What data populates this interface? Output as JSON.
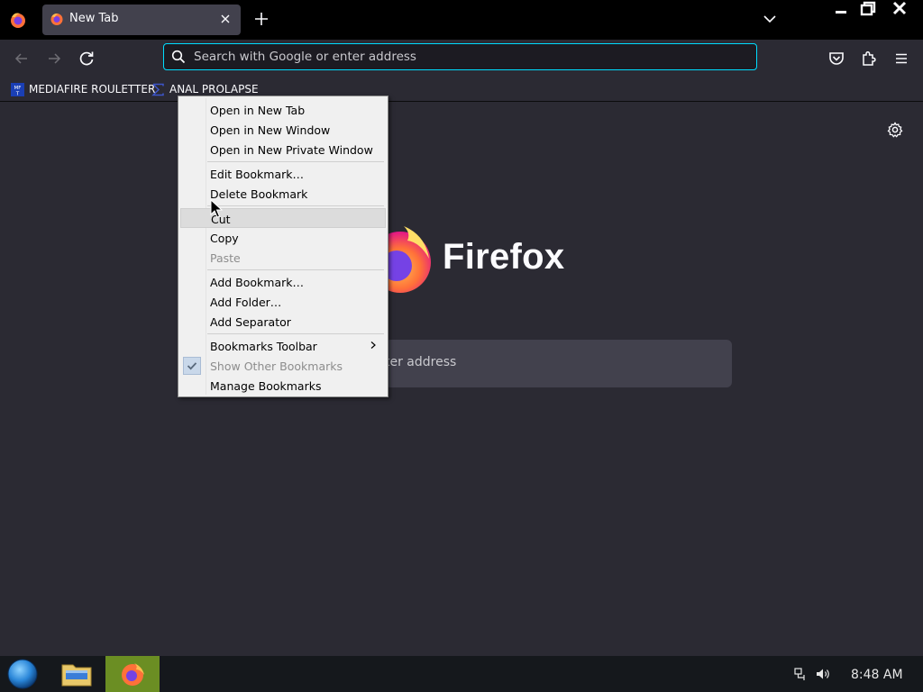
{
  "window": {
    "tab_title": "New Tab"
  },
  "navbar": {
    "url_placeholder": "Search with Google or enter address"
  },
  "bookmarks_bar": {
    "items": [
      {
        "label": "MEDIAFIRE ROULETTER",
        "favicon_text": "MF"
      },
      {
        "label": "ANAL PROLAPSE"
      }
    ]
  },
  "newtab": {
    "wordmark": "Firefox",
    "search_placeholder_visible": "ter address"
  },
  "context_menu": {
    "items": [
      {
        "label": "Open in New Tab",
        "enabled": true
      },
      {
        "label": "Open in New Window",
        "enabled": true
      },
      {
        "label": "Open in New Private Window",
        "enabled": true
      },
      {
        "label": "Edit Bookmark…",
        "enabled": true
      },
      {
        "label": "Delete Bookmark",
        "enabled": true
      },
      {
        "label": "Cut",
        "enabled": true,
        "hovered": true
      },
      {
        "label": "Copy",
        "enabled": true
      },
      {
        "label": "Paste",
        "enabled": false
      },
      {
        "label": "Add Bookmark…",
        "enabled": true
      },
      {
        "label": "Add Folder…",
        "enabled": true
      },
      {
        "label": "Add Separator",
        "enabled": true
      },
      {
        "label": "Bookmarks Toolbar",
        "enabled": true,
        "submenu": true
      },
      {
        "label": "Show Other Bookmarks",
        "enabled": false,
        "checked": true
      },
      {
        "label": "Manage Bookmarks",
        "enabled": true
      }
    ]
  },
  "taskbar": {
    "clock": "8:48 AM"
  },
  "colors": {
    "chrome_bg": "#2b2a33",
    "tab_strip_bg": "#000000",
    "urlbar_focus": "#00ddff",
    "taskbar_bg": "#15181c",
    "taskbar_active": "#6b8e23"
  }
}
